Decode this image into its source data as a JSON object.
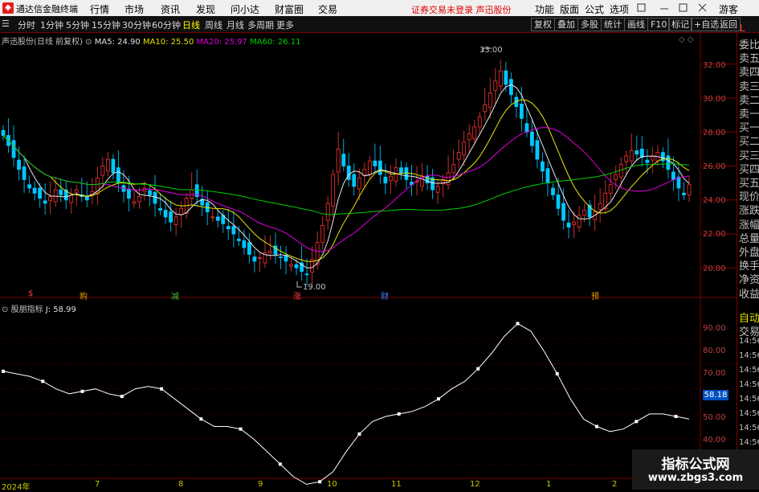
{
  "titlebar": {
    "app_name": "通达信金融终端",
    "menu": [
      "行情",
      "市场",
      "资讯",
      "发现",
      "问小达",
      "财富圈",
      "交易"
    ],
    "warning": "证券交易未登录 声迅股份",
    "right_menu": [
      "功能",
      "版面",
      "公式",
      "选项"
    ],
    "user": "游客"
  },
  "toolbar": {
    "timeframes": [
      "分时",
      "1分钟",
      "5分钟",
      "15分钟",
      "30分钟",
      "60分钟",
      "日线",
      "周线",
      "月线",
      "多周期",
      "更多"
    ],
    "active": "日线",
    "buttons": [
      "复权",
      "叠加",
      "多股",
      "统计",
      "画线",
      "F10",
      "标记",
      "+自选",
      "返回"
    ],
    "L_label": "L"
  },
  "price_panel": {
    "stock": "声迅股份(日线 前复权)",
    "ma5": "MA5: 24.90",
    "ma10": "MA10: 25.50",
    "ma20": "MA20: 25.97",
    "ma60": "MA60: 26.11",
    "high_label": "33.00",
    "low_label": "19.00",
    "y_ticks": [
      "32.00",
      "30.00",
      "28.00",
      "26.00",
      "24.00",
      "22.00",
      "20.00"
    ]
  },
  "events": [
    "$",
    "购",
    "减",
    "涨",
    "财",
    "预"
  ],
  "indicator_panel": {
    "name": "股朋指标",
    "j": "J: 58.99",
    "y_ticks": [
      "90.00",
      "80.00",
      "70.00",
      "60.00",
      "50.00",
      "40.00"
    ],
    "current": "58.18"
  },
  "x_labels": [
    "2024年",
    "7",
    "8",
    "9",
    "10",
    "11",
    "12",
    "1",
    "2"
  ],
  "side_panel": [
    "委比",
    "卖五",
    "卖四",
    "卖三",
    "卖二",
    "卖一",
    "买一",
    "买二",
    "买三",
    "买四",
    "买五",
    "现价",
    "涨跌",
    "涨幅",
    "总量",
    "外盘",
    "换手",
    "净资",
    "收益",
    "自动",
    "交易"
  ],
  "side_times": [
    "14:56",
    "14:56",
    "14:56",
    "14:56",
    "14:56",
    "14:56",
    "14:56",
    "14:56"
  ],
  "watermark": {
    "line1": "指标公式网",
    "line2": "www.zbgs3.com"
  },
  "chart_data": {
    "type": "candlestick",
    "y_range_price": [
      18.5,
      33.5
    ],
    "y_range_indicator": [
      35,
      100
    ],
    "closes": [
      27.8,
      27.2,
      26.5,
      25.8,
      25.2,
      24.7,
      24.4,
      24.1,
      23.8,
      24.2,
      24.6,
      24.3,
      24.0,
      24.3,
      24.6,
      24.2,
      24.0,
      24.5,
      25.3,
      26.0,
      26.4,
      25.6,
      25.0,
      24.5,
      24.1,
      23.9,
      24.2,
      24.7,
      24.3,
      23.8,
      23.4,
      23.0,
      22.7,
      23.0,
      23.5,
      24.1,
      24.6,
      24.2,
      23.7,
      23.3,
      23.0,
      22.8,
      22.6,
      22.3,
      22.0,
      21.6,
      21.2,
      20.8,
      20.4,
      20.6,
      20.9,
      21.0,
      20.8,
      20.6,
      20.4,
      20.2,
      20.0,
      19.8,
      19.6,
      20.5,
      21.5,
      22.5,
      23.8,
      25.5,
      27.0,
      26.0,
      25.2,
      24.8,
      25.3,
      25.8,
      26.3,
      26.0,
      25.5,
      25.0,
      25.4,
      25.9,
      25.6,
      25.2,
      24.9,
      25.1,
      25.4,
      25.0,
      24.6,
      24.8,
      25.2,
      25.6,
      26.1,
      26.8,
      27.4,
      27.9,
      28.3,
      28.9,
      29.6,
      30.3,
      31.0,
      31.6,
      30.8,
      30.2,
      29.5,
      28.8,
      28.0,
      27.2,
      26.4,
      25.7,
      25.0,
      24.3,
      23.5,
      22.8,
      22.4,
      22.7,
      23.1,
      23.4,
      23.0,
      23.3,
      23.8,
      24.4,
      24.9,
      25.5,
      26.1,
      26.6,
      26.9,
      26.7,
      26.5,
      26.2,
      26.6,
      26.8,
      26.3,
      25.8,
      25.2,
      24.7,
      24.3,
      24.9
    ],
    "indicator": [
      77,
      76,
      75,
      73,
      70,
      68,
      69,
      70,
      68,
      67,
      70,
      71,
      70,
      66,
      62,
      58,
      55,
      55,
      54,
      50,
      45,
      40,
      35,
      32,
      33,
      37,
      45,
      52,
      57,
      59,
      60,
      61,
      63,
      66,
      70,
      73,
      78,
      84,
      91,
      96,
      93,
      85,
      76,
      66,
      58,
      55,
      53,
      54,
      57,
      60,
      60,
      59,
      58
    ]
  }
}
